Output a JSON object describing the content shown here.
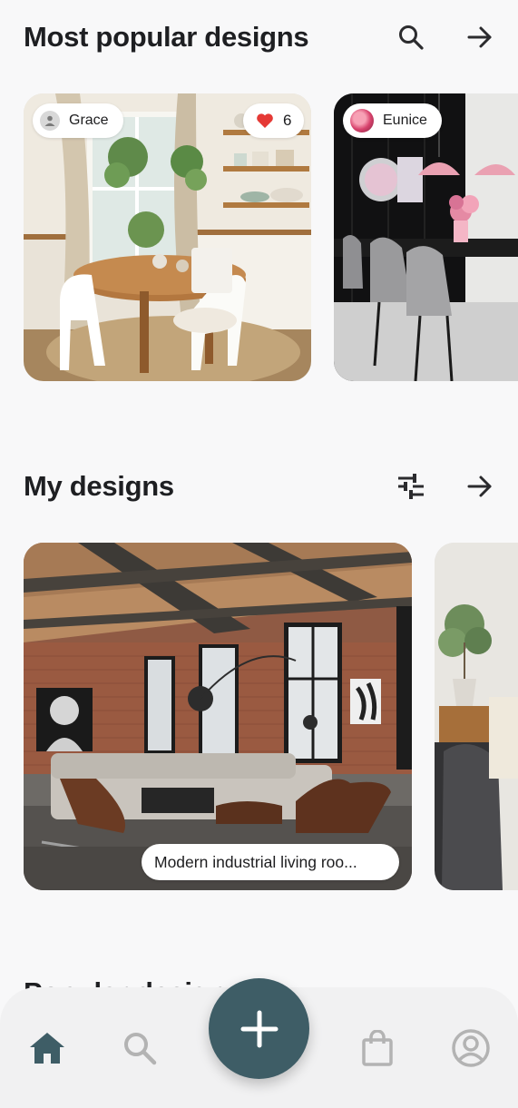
{
  "popular": {
    "title": "Most popular designs",
    "search_icon": "search-icon",
    "arrow_icon": "arrow-right-icon",
    "cards": [
      {
        "author": "Grace",
        "likes": "6",
        "avatar": "person-icon"
      },
      {
        "author": "Eunice",
        "avatar": "photo-avatar"
      }
    ]
  },
  "mine": {
    "title": "My designs",
    "filter_icon": "tune-icon",
    "arrow_icon": "arrow-right-icon",
    "cards": [
      {
        "caption": "Modern industrial living roo..."
      }
    ]
  },
  "next_section": {
    "title": "Popular designs"
  },
  "nav": {
    "items": [
      "home-icon",
      "search-icon",
      "add-icon",
      "shopping-bag-icon",
      "account-icon"
    ],
    "active": "home-icon"
  },
  "colors": {
    "accent": "#3e5d66",
    "background": "#f8f8f9",
    "like": "#e53935",
    "nav_inactive": "#b3b3b3"
  }
}
